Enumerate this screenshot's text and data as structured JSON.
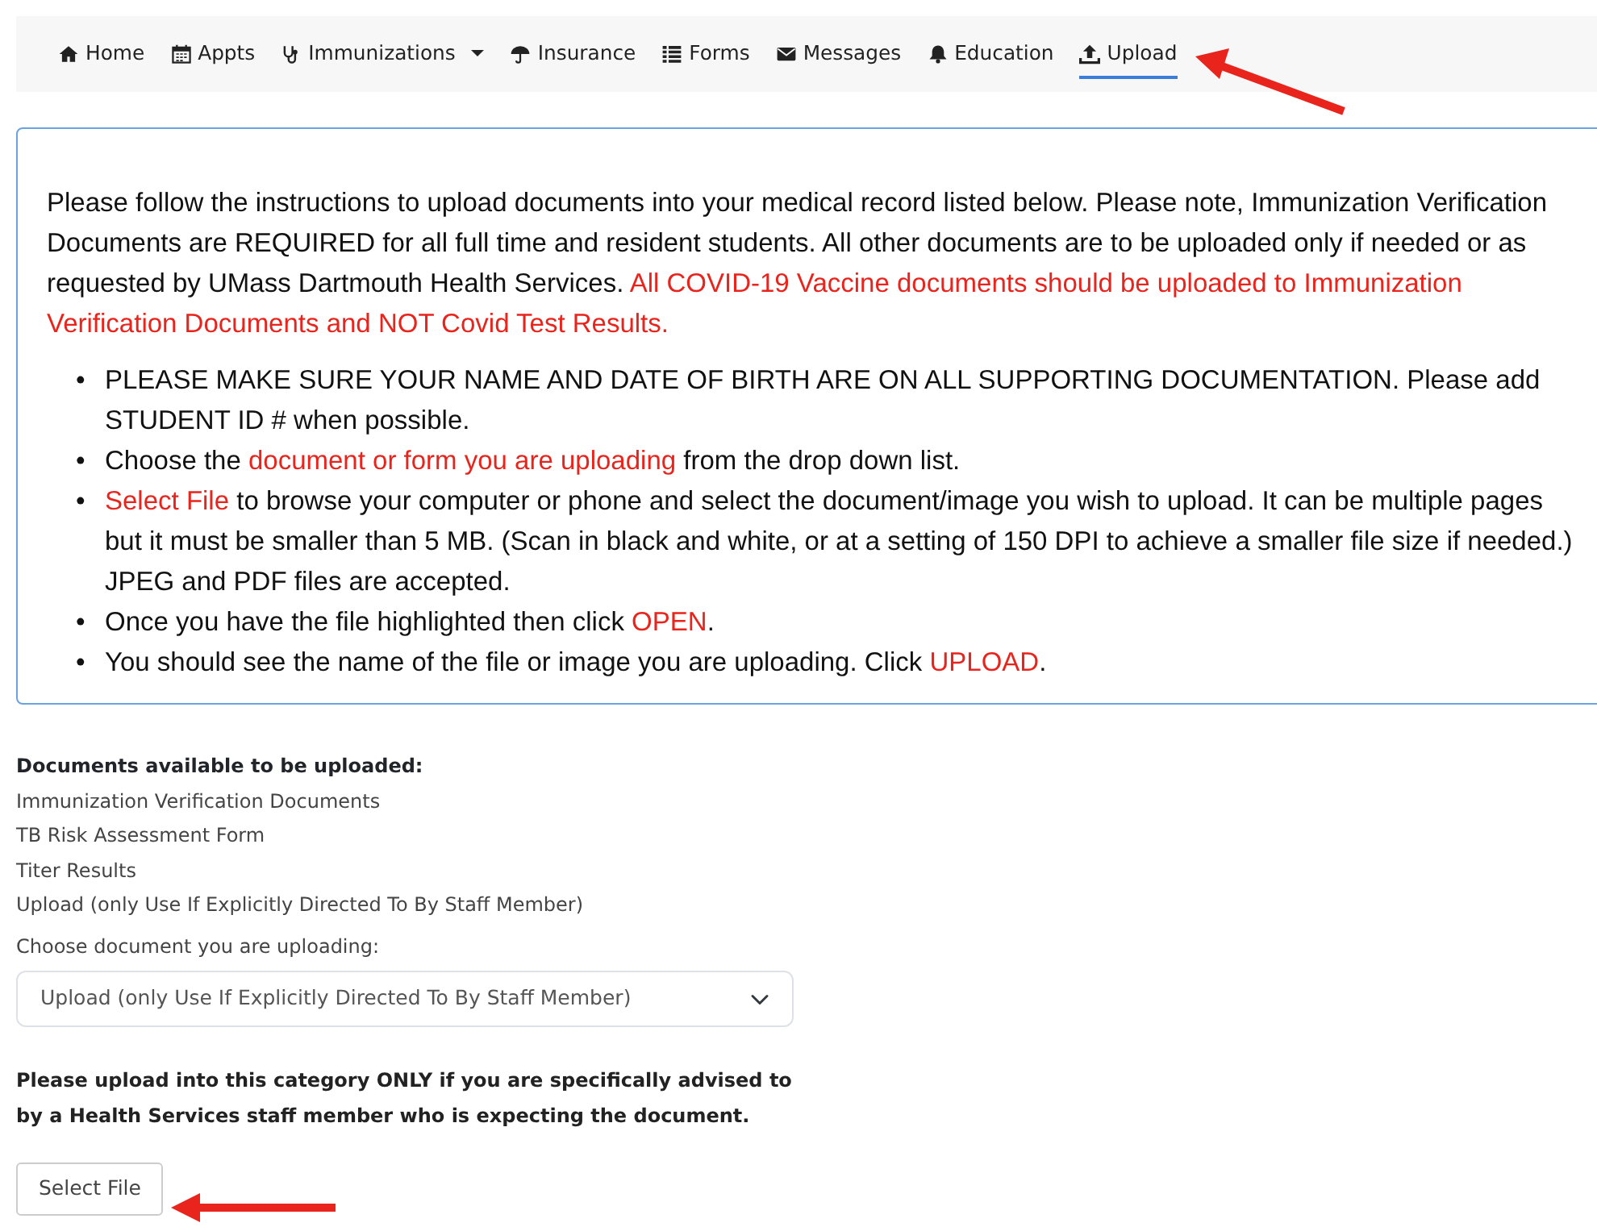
{
  "nav": [
    {
      "label": "Home",
      "selected": false,
      "dropdown": false
    },
    {
      "label": "Appts",
      "selected": false,
      "dropdown": false
    },
    {
      "label": "Immunizations",
      "selected": false,
      "dropdown": true
    },
    {
      "label": "Insurance",
      "selected": false,
      "dropdown": false
    },
    {
      "label": "Forms",
      "selected": false,
      "dropdown": false
    },
    {
      "label": "Messages",
      "selected": false,
      "dropdown": false
    },
    {
      "label": "Education",
      "selected": false,
      "dropdown": false
    },
    {
      "label": "Upload",
      "selected": true,
      "dropdown": false
    }
  ],
  "instructions": {
    "intro": [
      {
        "text": "Please follow the instructions to upload documents into your medical record listed below. Please note, Immunization Verification Documents are REQUIRED for all full time and resident students. All other documents are to be uploaded only if needed or as requested by UMass Dartmouth Health Services. ",
        "highlight": false
      },
      {
        "text": "All COVID-19 Vaccine documents should be uploaded to Immunization Verification Documents and NOT Covid Test Results.",
        "highlight": true
      }
    ],
    "marker": "•",
    "bullets": [
      [
        {
          "text": "PLEASE MAKE SURE YOUR NAME AND DATE OF BIRTH ARE ON ALL SUPPORTING DOCUMENTATION. Please add STUDENT ID # when possible.",
          "highlight": false
        }
      ],
      [
        {
          "text": "Choose the ",
          "highlight": false
        },
        {
          "text": "document or form you are uploading",
          "highlight": true
        },
        {
          "text": " from the drop down list.",
          "highlight": false
        }
      ],
      [
        {
          "text": "Select File",
          "highlight": true
        },
        {
          "text": " to browse your computer or phone and select the document/image you wish to upload. It can be multiple pages but it must be smaller than 5 MB. (Scan in black and white, or at a setting of 150 DPI to achieve a smaller file size if needed.) JPEG and PDF files are accepted.",
          "highlight": false
        }
      ],
      [
        {
          "text": "Once you have the file highlighted then click ",
          "highlight": false
        },
        {
          "text": "OPEN",
          "highlight": true
        },
        {
          "text": ".",
          "highlight": false
        }
      ],
      [
        {
          "text": "You should see the name of the file or image you are uploading. Click ",
          "highlight": false
        },
        {
          "text": "UPLOAD",
          "highlight": true
        },
        {
          "text": ".",
          "highlight": false
        }
      ]
    ]
  },
  "documents": {
    "heading": "Documents available to be uploaded:",
    "items": [
      "Immunization Verification Documents",
      "TB Risk Assessment Form",
      "Titer Results",
      "Upload (only Use If Explicitly Directed To By Staff Member)"
    ]
  },
  "select": {
    "label": "Choose document you are uploading:",
    "value": "Upload (only Use If Explicitly Directed To By Staff Member)"
  },
  "notice": "Please upload into this category ONLY if you are specifically advised to by a Health Services staff member who is expecting the document.",
  "button": "Select File"
}
